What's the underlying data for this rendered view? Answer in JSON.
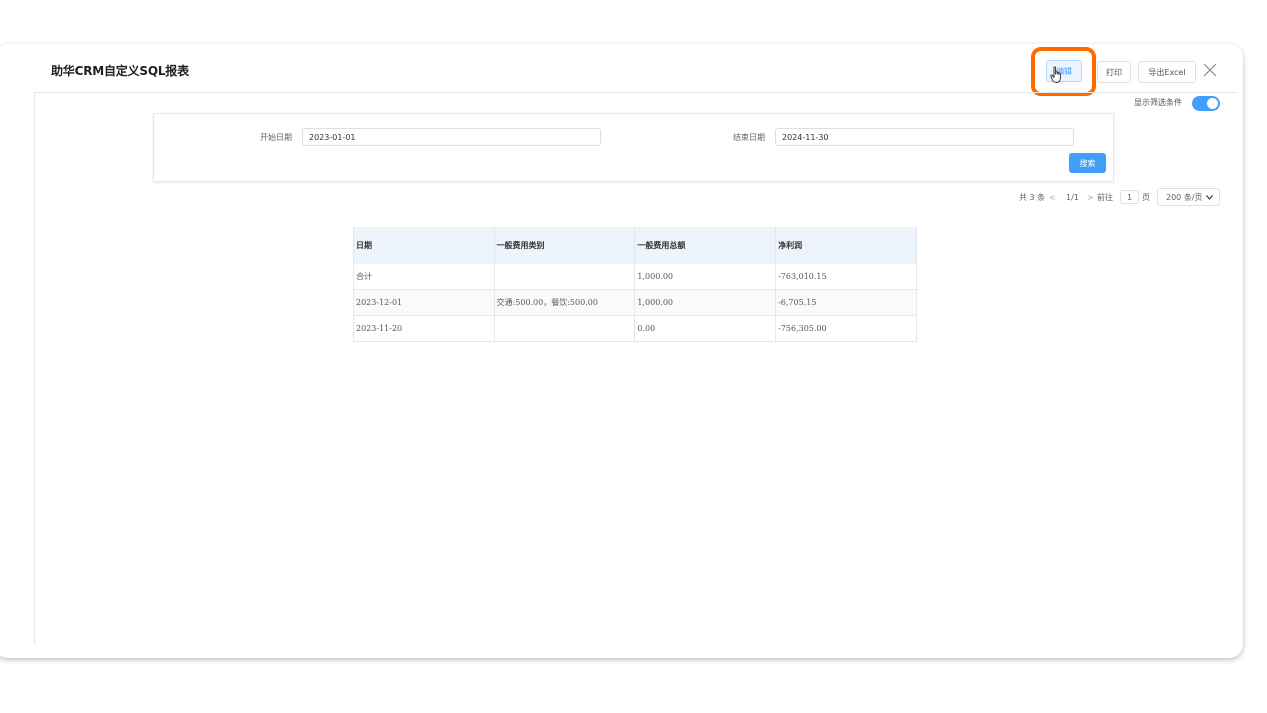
{
  "header": {
    "title": "助华CRM自定义SQL报表",
    "edit_label": "编辑",
    "print_label": "打印",
    "export_label": "导出Excel"
  },
  "filters": {
    "toggle_label": "显示筛选条件",
    "toggle_on": true,
    "start_label": "开始日期",
    "start_value": "2023-01-01",
    "end_label": "结束日期",
    "end_value": "2024-11-30",
    "search_label": "搜索"
  },
  "pagination": {
    "total_text": "共 3 条",
    "prev": "<",
    "page_info": "1/1",
    "next": ">",
    "goto_label": "前往",
    "goto_value": "1",
    "page_suffix": "页",
    "page_size": "200 条/页"
  },
  "table": {
    "headers": [
      "日期",
      "一般费用类别",
      "一般费用总额",
      "净利润"
    ],
    "rows": [
      [
        "合计",
        "",
        "1,000.00",
        "-763,010.15"
      ],
      [
        "2023-12-01",
        "交通:500.00，餐饮:500.00",
        "1,000.00",
        "-6,705.15"
      ],
      [
        "2023-11-20",
        "",
        "0.00",
        "-756,305.00"
      ]
    ]
  },
  "colors": {
    "accent": "#409eff",
    "highlight": "#ff6a00"
  }
}
